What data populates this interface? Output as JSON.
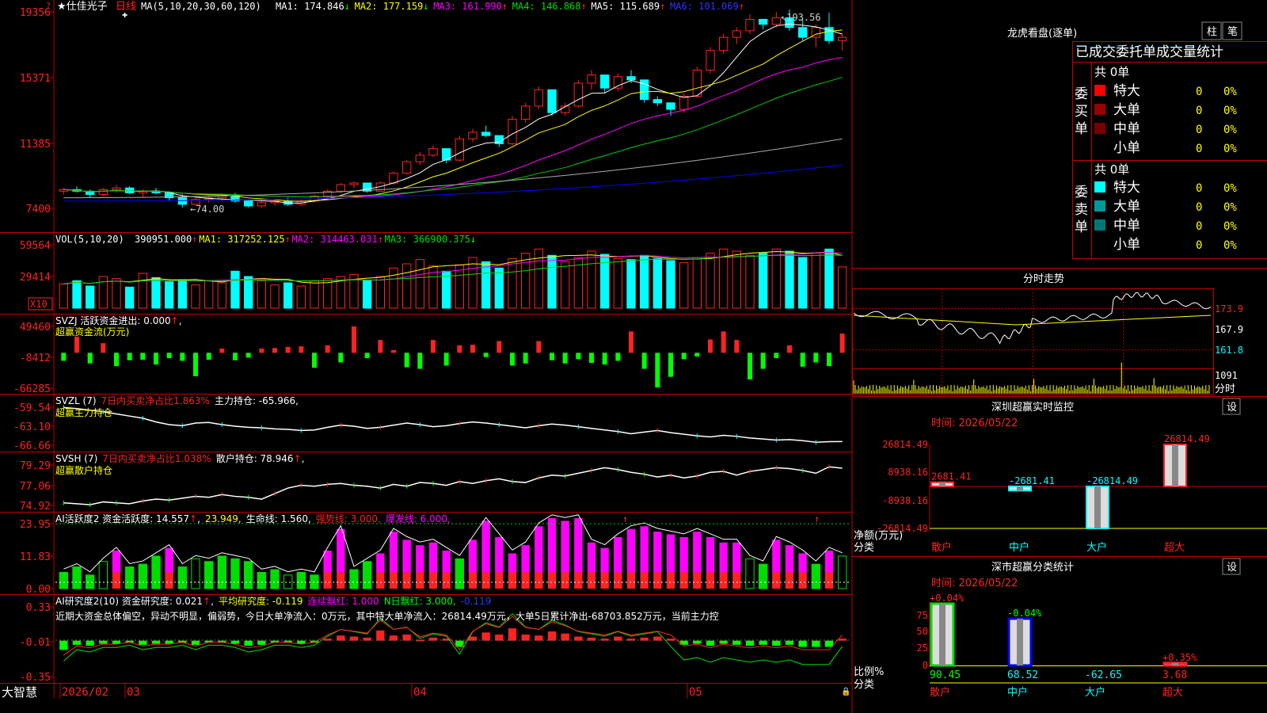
{
  "app": {
    "brand": "大智慧"
  },
  "stock": {
    "name": "★仕佳光子",
    "period": "日线"
  },
  "colors": {
    "up": "#ff2222",
    "down": "#00ffff",
    "bg": "#000000",
    "border": "#c00000",
    "ma1": "#ffffff",
    "ma2": "#ffff00",
    "ma3": "#ff00ff",
    "ma4": "#00cc00",
    "ma5": "#aaaaaa",
    "ma6": "#0000ff"
  },
  "kline": {
    "header": {
      "label": "MA(5,10,20,30,60,120)",
      "items": [
        {
          "text": "MA1: 174.846",
          "arrow": "↓",
          "color": "#ffffff",
          "arrowColor": "#00ff00"
        },
        {
          "text": "MA2: 177.159",
          "arrow": "↓",
          "color": "#ffff00",
          "arrowColor": "#00ff00"
        },
        {
          "text": "MA3: 161.990",
          "arrow": "↑",
          "color": "#ff00ff",
          "arrowColor": "#ff2222"
        },
        {
          "text": "MA4: 146.868",
          "arrow": "↑",
          "color": "#00dd00",
          "arrowColor": "#ff2222"
        },
        {
          "text": "MA5: 115.689",
          "arrow": "↑",
          "color": "#ffffff",
          "arrowColor": "#ff2222"
        },
        {
          "text": "MA6: 101.069",
          "arrow": "↑",
          "color": "#3333ff",
          "arrowColor": "#ff2222"
        }
      ]
    },
    "y_ticks": [
      "19356",
      "15371",
      "11385",
      "7400"
    ],
    "annotations": {
      "high": "193.56",
      "low": "74.00"
    }
  },
  "volume": {
    "header": {
      "label": "VOL(5,10,20)",
      "items": [
        {
          "text": "390951.000",
          "arrow": "↑",
          "color": "#ffffff",
          "arrowColor": "#ff2222"
        },
        {
          "text": "MA1: 317252.125",
          "arrow": "↑",
          "color": "#ffff00",
          "arrowColor": "#ff2222"
        },
        {
          "text": "MA2: 314463.031",
          "arrow": "↑",
          "color": "#ff00ff",
          "arrowColor": "#ff2222"
        },
        {
          "text": "MA3: 366900.375",
          "arrow": "↓",
          "color": "#00dd00",
          "arrowColor": "#00ff00"
        }
      ]
    },
    "y_ticks": [
      "59564",
      "29414"
    ],
    "unit": "X10"
  },
  "svzj": {
    "header1": "SVZJ  活跃资金进出: 0.000",
    "header2": "超赢资金流(万元)",
    "y_ticks": [
      "49460",
      "-8412",
      "-66285"
    ]
  },
  "svzl": {
    "label": "SVZL (7)",
    "item1": "7日内买卖净占比1.863%",
    "item2": "主力持仓: -65.966,",
    "header2": "超赢主力持仓",
    "y_ticks": [
      "-59.54",
      "-63.10",
      "-66.66"
    ]
  },
  "svsh": {
    "label": "SVSH (7)",
    "item1": "7日内买卖净占比1.038%",
    "item2": "散户持仓: 78.946",
    "header2": "超赢散户持仓",
    "y_ticks": [
      "79.29",
      "77.06",
      "74.92"
    ]
  },
  "ai1": {
    "label": "AI活跃度2 资金活跃度: 14.557",
    "items": [
      {
        "text": "23.949,",
        "color": "#ffff00"
      },
      {
        "text": "生命线: 1.560,",
        "color": "#ffffff"
      },
      {
        "text": "强势线: 3.000,",
        "color": "#ff2222"
      },
      {
        "text": "爆发线: 6.000,",
        "color": "#ff00ff"
      }
    ],
    "y_ticks": [
      "23.95",
      "11.83",
      "0.00"
    ]
  },
  "ai2": {
    "label": "AI研究度2(10) 资金研究度: 0.021",
    "items": [
      {
        "text": "平均研究度: -0.119",
        "color": "#ffff00"
      },
      {
        "text": "连续飘红: 1.000",
        "color": "#ff00ff"
      },
      {
        "text": "N日飘红: 3.000,",
        "color": "#00ff00"
      },
      {
        "text": "-0.119",
        "color": "#3333ff"
      }
    ],
    "comment": "近期大资金总体偏空，异动不明显，偏弱势，今日大单净流入：0万元，其中特大单净流入：26814.49万元，大单5日累计净出-68703.852万元，当前主力控",
    "y_ticks": [
      "0.33",
      "-0.01",
      "-0.35"
    ]
  },
  "xaxis": {
    "labels": [
      "2026/02",
      "03",
      "04",
      "05"
    ]
  },
  "lhb": {
    "title": "龙虎看盘(逐单)",
    "btn_col": "柱",
    "btn_pen": "笔",
    "tabs": "已成交委托单成交量统计",
    "buy_side": "委买单",
    "sell_side": "委卖单",
    "buy_total": "共 0单",
    "sell_total": "共 0单",
    "buy_rows": [
      {
        "label": "特大",
        "count": "0",
        "pct": "0%",
        "color": "#ff0000"
      },
      {
        "label": "大单",
        "count": "0",
        "pct": "0%",
        "color": "#990000"
      },
      {
        "label": "中单",
        "count": "0",
        "pct": "0%",
        "color": "#770000"
      },
      {
        "label": "小单",
        "count": "0",
        "pct": "0%",
        "color": ""
      }
    ],
    "sell_rows": [
      {
        "label": "特大",
        "count": "0",
        "pct": "0%",
        "color": "#00ffff"
      },
      {
        "label": "大单",
        "count": "0",
        "pct": "0%",
        "color": "#009999"
      },
      {
        "label": "中单",
        "count": "0",
        "pct": "0%",
        "color": "#007777"
      },
      {
        "label": "小单",
        "count": "0",
        "pct": "0%",
        "color": ""
      }
    ]
  },
  "intraday": {
    "title": "分时走势",
    "price_ticks": [
      "173.9",
      "167.9",
      "161.8"
    ],
    "vol_label": "1091",
    "unit": "分时"
  },
  "monitor": {
    "title": "深圳超赢实时监控",
    "settings": "设",
    "time": "时间: 2026/05/22",
    "y_ticks": [
      "26814.49",
      "8938.16",
      "-8938.16",
      "-26814.49"
    ],
    "ylabel": "净额(万元)",
    "xlabel": "分类",
    "categories": [
      "散户",
      "中户",
      "大户",
      "超大"
    ],
    "values": [
      2681.41,
      -2681.41,
      -26814.49,
      26814.49
    ],
    "labels": [
      "2681.41",
      "-2681.41",
      "-26814.49",
      "26814.49"
    ]
  },
  "classify": {
    "title": "深市超赢分类统计",
    "settings": "设",
    "time": "时间: 2026/05/22",
    "y_ticks": [
      "75",
      "50",
      "25",
      "0"
    ],
    "ylabel": "比例%",
    "xlabel": "分类",
    "categories": [
      "散户",
      "中户",
      "大户",
      "超大"
    ],
    "bar_pct": [
      90.45,
      68.52,
      0,
      3.68
    ],
    "top_labels": [
      "+0.04%",
      "-0.04%",
      "",
      "+0.35%"
    ],
    "bottom_labels": [
      "90.45",
      "68.52",
      "-62.65",
      "3.68"
    ]
  },
  "chart_data": {
    "type": "candlestick",
    "x_labels": [
      "2026/02",
      "03",
      "04",
      "05"
    ],
    "candles": [
      [
        84,
        86,
        82,
        85
      ],
      [
        85,
        87,
        83,
        84
      ],
      [
        84,
        85,
        80,
        82
      ],
      [
        82,
        86,
        81,
        85
      ],
      [
        85,
        88,
        83,
        86
      ],
      [
        86,
        87,
        82,
        83
      ],
      [
        83,
        85,
        80,
        84
      ],
      [
        84,
        86,
        82,
        83
      ],
      [
        83,
        84,
        78,
        80
      ],
      [
        80,
        82,
        74,
        76
      ],
      [
        76,
        80,
        75,
        79
      ],
      [
        79,
        81,
        77,
        80
      ],
      [
        80,
        82,
        78,
        81
      ],
      [
        81,
        83,
        77,
        78
      ],
      [
        78,
        79,
        74,
        75
      ],
      [
        75,
        78,
        74,
        77
      ],
      [
        77,
        79,
        75,
        78
      ],
      [
        78,
        80,
        75,
        76
      ],
      [
        76,
        79,
        75,
        78
      ],
      [
        78,
        82,
        77,
        81
      ],
      [
        81,
        85,
        80,
        84
      ],
      [
        84,
        89,
        83,
        88
      ],
      [
        88,
        90,
        86,
        89
      ],
      [
        89,
        88,
        83,
        84
      ],
      [
        84,
        90,
        84,
        89
      ],
      [
        89,
        96,
        88,
        95
      ],
      [
        95,
        103,
        94,
        102
      ],
      [
        102,
        108,
        100,
        106
      ],
      [
        106,
        112,
        105,
        110
      ],
      [
        110,
        107,
        101,
        103
      ],
      [
        103,
        118,
        102,
        116
      ],
      [
        116,
        122,
        114,
        120
      ],
      [
        120,
        124,
        117,
        118
      ],
      [
        118,
        116,
        111,
        113
      ],
      [
        113,
        130,
        112,
        128
      ],
      [
        128,
        138,
        126,
        136
      ],
      [
        136,
        148,
        134,
        146
      ],
      [
        146,
        140,
        130,
        132
      ],
      [
        132,
        138,
        130,
        136
      ],
      [
        136,
        152,
        135,
        150
      ],
      [
        150,
        158,
        146,
        155
      ],
      [
        155,
        150,
        144,
        147
      ],
      [
        147,
        156,
        145,
        154
      ],
      [
        154,
        158,
        150,
        152
      ],
      [
        152,
        144,
        138,
        140
      ],
      [
        140,
        142,
        136,
        138
      ],
      [
        138,
        135,
        130,
        134
      ],
      [
        134,
        144,
        132,
        142
      ],
      [
        142,
        160,
        141,
        158
      ],
      [
        158,
        172,
        156,
        170
      ],
      [
        170,
        180,
        168,
        178
      ],
      [
        178,
        184,
        174,
        182
      ],
      [
        182,
        192,
        180,
        189
      ],
      [
        189,
        188,
        183,
        186
      ],
      [
        186,
        193.56,
        184,
        190
      ],
      [
        190,
        195,
        182,
        184
      ],
      [
        184,
        190,
        176,
        178
      ],
      [
        178,
        186,
        172,
        184
      ],
      [
        184,
        193,
        174,
        176
      ],
      [
        176,
        180,
        170,
        178
      ]
    ],
    "volume": [
      230,
      260,
      210,
      300,
      280,
      200,
      330,
      290,
      250,
      270,
      220,
      260,
      240,
      350,
      300,
      260,
      220,
      240,
      210,
      260,
      280,
      300,
      320,
      260,
      300,
      380,
      420,
      460,
      400,
      350,
      410,
      480,
      440,
      380,
      470,
      520,
      560,
      500,
      440,
      480,
      540,
      510,
      470,
      460,
      500,
      470,
      450,
      430,
      480,
      520,
      560,
      540,
      500,
      520,
      560,
      540,
      480,
      520,
      560,
      391
    ],
    "svzj": [
      -15000,
      30000,
      -20000,
      18000,
      -25000,
      -14000,
      -13000,
      -22000,
      -10000,
      -15000,
      -44000,
      -13000,
      8000,
      -14000,
      -9000,
      8000,
      9000,
      11000,
      12000,
      -28000,
      14000,
      -18000,
      49460,
      -10000,
      24000,
      5000,
      -27000,
      -30000,
      24000,
      -24000,
      14000,
      15000,
      -8000,
      22000,
      -24000,
      -20000,
      22000,
      -14000,
      -20000,
      -12000,
      -19000,
      -22000,
      -15000,
      40000,
      -30000,
      -65000,
      -45000,
      -12000,
      -7000,
      25000,
      40000,
      24000,
      -50000,
      -30000,
      -10000,
      14000,
      -26000,
      -18000,
      -25000,
      36000
    ],
    "svzl": [
      -59.6,
      -59.8,
      -60.1,
      -60.4,
      -60.8,
      -61.2,
      -61.6,
      -62.3,
      -62.8,
      -63.0,
      -62.5,
      -62.4,
      -62.8,
      -63.1,
      -63.3,
      -63.4,
      -63.6,
      -63.7,
      -63.9,
      -63.8,
      -63.3,
      -62.9,
      -63.1,
      -63.5,
      -63.3,
      -62.9,
      -62.5,
      -62.8,
      -63.2,
      -63.0,
      -62.6,
      -62.3,
      -62.5,
      -62.8,
      -63.1,
      -63.4,
      -63.0,
      -62.7,
      -62.9,
      -63.2,
      -63.5,
      -63.8,
      -64.1,
      -64.5,
      -64.2,
      -63.9,
      -64.3,
      -64.6,
      -64.9,
      -65.1,
      -64.8,
      -65.0,
      -65.3,
      -65.5,
      -65.7,
      -65.6,
      -65.8,
      -66.1,
      -66.0,
      -65.97
    ],
    "svsh": [
      75.2,
      75.1,
      75.0,
      75.3,
      75.2,
      75.1,
      75.4,
      75.6,
      75.5,
      75.7,
      75.9,
      75.8,
      76.1,
      75.9,
      75.8,
      75.6,
      76.2,
      76.8,
      77.1,
      77.0,
      77.2,
      77.3,
      77.1,
      77.0,
      76.8,
      77.2,
      77.0,
      77.4,
      77.3,
      77.1,
      77.5,
      77.3,
      77.6,
      77.8,
      77.5,
      77.4,
      77.9,
      78.2,
      78.1,
      78.4,
      78.7,
      79.0,
      78.8,
      78.5,
      78.3,
      78.0,
      78.2,
      77.9,
      78.1,
      78.5,
      78.6,
      78.2,
      78.6,
      78.8,
      79.0,
      78.9,
      78.7,
      78.4,
      79.1,
      78.95
    ],
    "ai1_bars": [
      6,
      8,
      5,
      10,
      14,
      8,
      9,
      12,
      15,
      8,
      11,
      10,
      12,
      11,
      10,
      6,
      7,
      5,
      6,
      5,
      14,
      22,
      7,
      10,
      13,
      21,
      18,
      16,
      17,
      14,
      11,
      18,
      25,
      19,
      13,
      16,
      23,
      26,
      25,
      26,
      17,
      15,
      19,
      22,
      23,
      21,
      20,
      19,
      21,
      19,
      17,
      17,
      11,
      9,
      18,
      16,
      13,
      9,
      14,
      12
    ],
    "ai2_bars": [
      -0.09,
      -0.04,
      -0.05,
      -0.03,
      -0.03,
      -0.02,
      -0.04,
      -0.03,
      -0.03,
      -0.02,
      -0.04,
      -0.02,
      -0.02,
      -0.03,
      -0.05,
      -0.04,
      -0.02,
      -0.02,
      -0.03,
      -0.02,
      0.02,
      0.05,
      0.04,
      0.03,
      0.1,
      0.05,
      0.06,
      0.01,
      0.03,
      0.02,
      -0.06,
      0.04,
      0.08,
      0.06,
      0.12,
      0.06,
      0.05,
      0.09,
      0.07,
      0.04,
      0.03,
      0.02,
      0.04,
      0.02,
      0.03,
      0.04,
      0.02,
      -0.04,
      -0.03,
      -0.05,
      -0.03,
      -0.04,
      -0.05,
      -0.04,
      -0.05,
      -0.04,
      -0.06,
      -0.06,
      -0.06,
      0.02
    ]
  }
}
